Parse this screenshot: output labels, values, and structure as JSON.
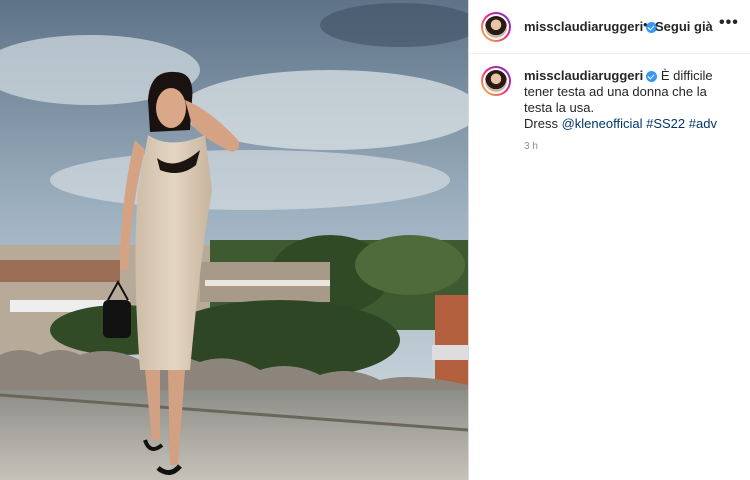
{
  "post": {
    "username": "missclaudiaruggeri",
    "follow_label": "Segui già",
    "separator": "•",
    "more_label": "•••",
    "caption_text": "È difficile tener testa ad una donna che la testa la usa.",
    "caption_line2_prefix": "Dress",
    "mention": "@kleneofficial",
    "hashtags": [
      "#SS22",
      "#adv"
    ],
    "timestamp": "3 h"
  },
  "colors": {
    "verified": "#3897f0",
    "link": "#00376b",
    "muted": "#8e8e8e"
  },
  "icons": {
    "verified": "verified-badge-icon",
    "more": "more-options-icon"
  }
}
